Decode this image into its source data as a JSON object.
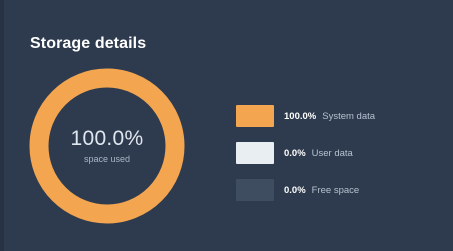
{
  "title": "Storage details",
  "summary": {
    "percent": "100.0%",
    "label": "space used",
    "fraction_used": 1.0
  },
  "colors": {
    "system": "#f4a54f",
    "user": "#e9eef3",
    "free": "#3f4d60",
    "background": "#2e3b4e"
  },
  "legend": [
    {
      "value": "100.0%",
      "label": "System data",
      "color": "#f4a54f"
    },
    {
      "value": "0.0%",
      "label": "User data",
      "color": "#e9eef3"
    },
    {
      "value": "0.0%",
      "label": "Free space",
      "color": "#3f4d60"
    }
  ]
}
